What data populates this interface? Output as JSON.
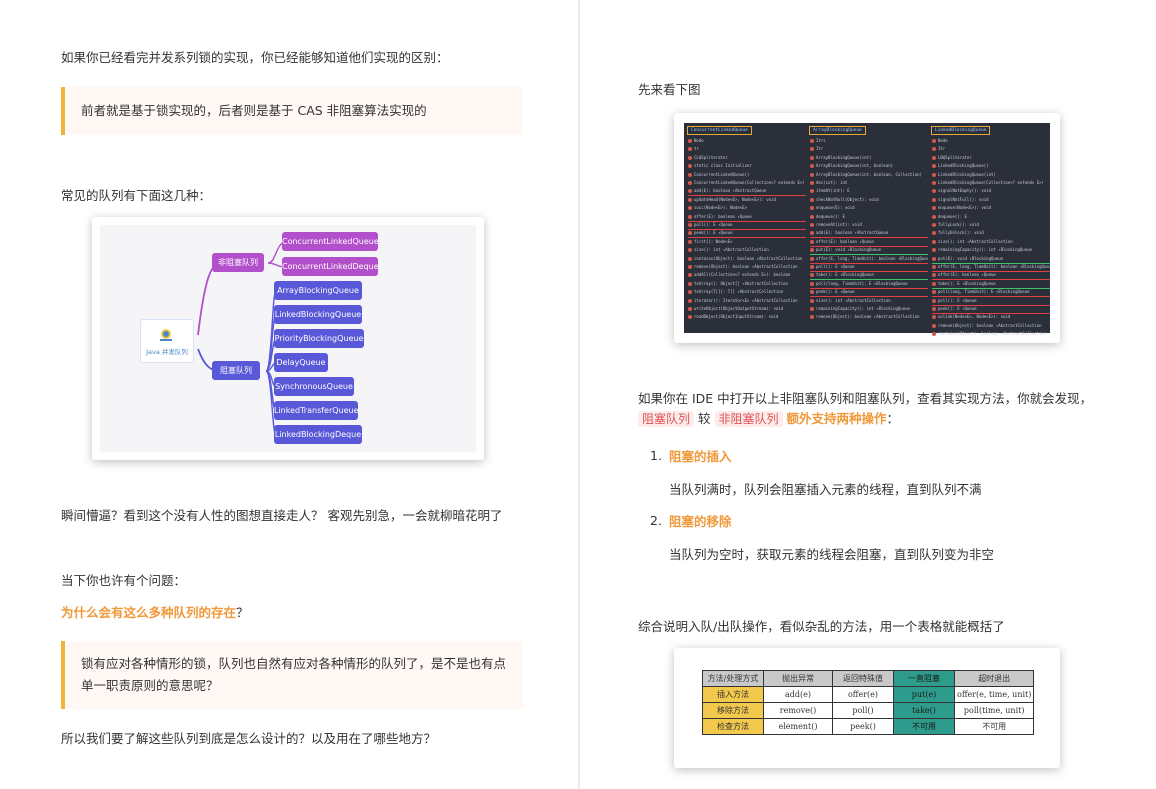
{
  "left": {
    "p1": "如果你已经看完并发系列锁的实现，你已经能够知道他们实现的区别：",
    "quote1": "前者就是基于锁实现的，后者则是基于 CAS 非阻塞算法实现的",
    "p2": "常见的队列有下面这几种：",
    "mindmap": {
      "root": "Java 并发队列",
      "nonblocking": {
        "label": "非阻塞队列",
        "items": [
          "ConcurrentLinkedQueue",
          "ConcurrentLinkedDeque"
        ]
      },
      "blocking": {
        "label": "阻塞队列",
        "items": [
          "ArrayBlockingQueue",
          "LinkedBlockingQueue",
          "PriorityBlockingQueue",
          "DelayQueue",
          "SynchronousQueue",
          "LinkedTransferQueue",
          "LinkedBlockingDeque"
        ]
      }
    },
    "p3": "瞬间懵逼？看到这个没有人性的图想直接走人？ 客观先别急，一会就柳暗花明了",
    "p4": "当下你也许有个问题：",
    "question_orange": "为什么会有这么多种队列的存在",
    "question_mark": "？",
    "quote2": "锁有应对各种情形的锁，队列也自然有应对各种情形的队列了，是不是也有点单一职责原则的意思呢？",
    "p5": "所以我们要了解这些队列到底是怎么设计的？以及用在了哪些地方？"
  },
  "right": {
    "p1": "先来看下图",
    "ide": {
      "columns": [
        {
          "header": "ConcurrentLinkedQueue",
          "rows": [
            "Node",
            "tr",
            "CLQSpliterator",
            "static class Initializer",
            "ConcurrentLinkedQueue()",
            "ConcurrentLinkedQueue(Collection<? extends E>)",
            "add(E): boolean ↑AbstractQueue",
            "updateHead(Node<E>, Node<E>): void",
            "succ(Node<E>): Node<E>",
            "offer(E): boolean ↑Queue",
            "poll(): E ↑Queue",
            "peek(): E ↑Queue",
            "first(): Node<E>",
            "size(): int ↑AbstractCollection",
            "contains(Object): boolean ↑AbstractCollection",
            "remove(Object): boolean ↑AbstractCollection",
            "addAll(Collection<? extends E>): boolean",
            "toArray(): Object[] ↑AbstractCollection",
            "toArray(T[]): T[] ↑AbstractCollection",
            "iterator(): Iterator<E> ↑AbstractCollection",
            "writeObject(ObjectOutputStream): void",
            "readObject(ObjectInputStream): void"
          ]
        },
        {
          "header": "ArrayBlockingQueue",
          "rows": [
            "Itrs",
            "Itr",
            "ArrayBlockingQueue(int)",
            "ArrayBlockingQueue(int, boolean)",
            "ArrayBlockingQueue(int, boolean, Collection)",
            "dec(int): int",
            "itemAt(int): E",
            "checkNotNull(Object): void",
            "enqueue(E): void",
            "dequeue(): E",
            "removeAt(int): void",
            "add(E): boolean ↑AbstractQueue",
            "offer(E): boolean ↑Queue",
            "put(E): void ↑BlockingQueue",
            "offer(E, long, TimeUnit): boolean ↑BlockingQueue",
            "poll(): E ↑Queue",
            "take(): E ↑BlockingQueue",
            "poll(long, TimeUnit): E ↑BlockingQueue",
            "peek(): E ↑Queue",
            "size(): int ↑AbstractCollection",
            "remainingCapacity(): int ↑BlockingQueue",
            "remove(Object): boolean ↑AbstractCollection"
          ]
        },
        {
          "header": "LinkedBlockingQueue",
          "rows": [
            "Node",
            "Itr",
            "LBQSpliterator",
            "LinkedBlockingQueue()",
            "LinkedBlockingQueue(int)",
            "LinkedBlockingQueue(Collection<? extends E>)",
            "signalNotEmpty(): void",
            "signalNotFull(): void",
            "enqueue(Node<E>): void",
            "dequeue(): E",
            "fullyLock(): void",
            "fullyUnlock(): void",
            "size(): int ↑AbstractCollection",
            "remainingCapacity(): int ↑BlockingQueue",
            "put(E): void ↑BlockingQueue",
            "offer(E, long, TimeUnit): boolean ↑BlockingQueue",
            "offer(E): boolean ↑Queue",
            "take(): E ↑BlockingQueue",
            "poll(long, TimeUnit): E ↑BlockingQueue",
            "poll(): E ↑Queue",
            "peek(): E ↑Queue",
            "unlink(Node<E>, Node<E>): void",
            "remove(Object): boolean ↑AbstractCollection",
            "contains(Object): boolean ↑AbstractCollection"
          ]
        }
      ]
    },
    "p2_line1": "如果你在 IDE 中打开以上非阻塞队列和阻塞队列，查看其实现方法，你就会发现，",
    "tag_blocking": "阻塞队列",
    "than": "较",
    "tag_nonblocking": "非阻塞队列",
    "extra_ops": "额外支持两种操作",
    "colon": "：",
    "list": [
      {
        "num": "1.",
        "title": "阻塞的插入",
        "desc": "当队列满时，队列会阻塞插入元素的线程，直到队列不满"
      },
      {
        "num": "2.",
        "title": "阻塞的移除",
        "desc": "当队列为空时，获取元素的线程会阻塞，直到队列变为非空"
      }
    ],
    "p3": "综合说明入队/出队操作，看似杂乱的方法，用一个表格就能概括了",
    "table": {
      "header": [
        "方法/处理方式",
        "抛出异常",
        "返回特殊值",
        "一直阻塞",
        "超时退出"
      ],
      "rows": [
        [
          "插入方法",
          "add(e)",
          "offer(e)",
          "put(e)",
          "offer(e, time, unit)"
        ],
        [
          "移除方法",
          "remove()",
          "poll()",
          "take()",
          "poll(time, unit)"
        ],
        [
          "检查方法",
          "element()",
          "peek()",
          "不可用",
          "不可用"
        ]
      ]
    }
  }
}
